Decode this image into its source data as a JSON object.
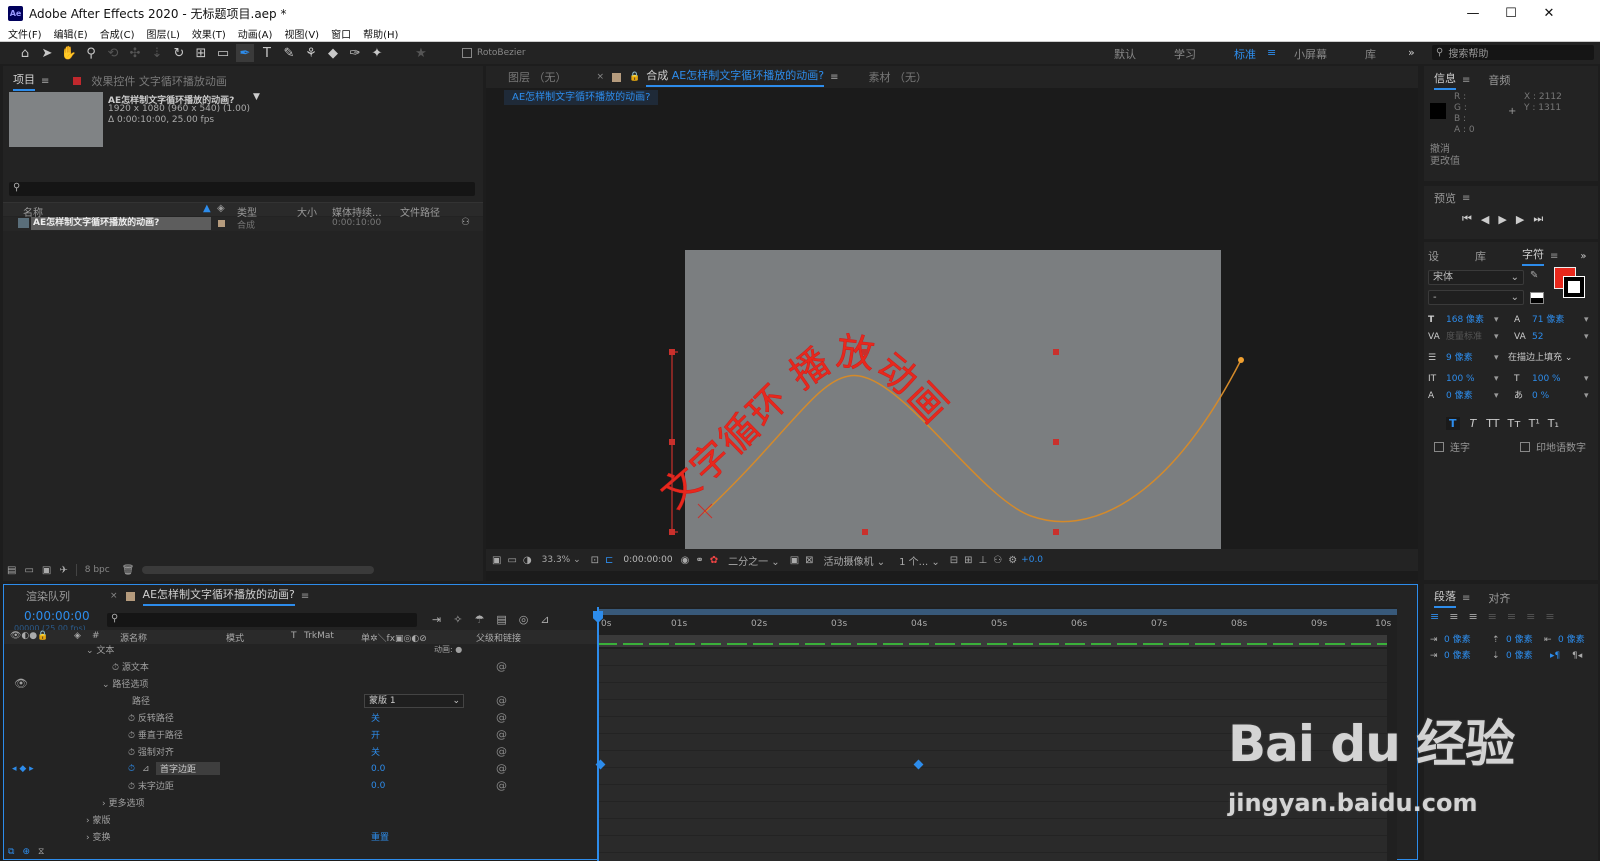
{
  "window": {
    "title": "Adobe After Effects 2020 - 无标题项目.aep *",
    "minimize": "—",
    "maximize": "☐",
    "close": "✕"
  },
  "menu": [
    "文件(F)",
    "编辑(E)",
    "合成(C)",
    "图层(L)",
    "效果(T)",
    "动画(A)",
    "视图(V)",
    "窗口",
    "帮助(H)"
  ],
  "toolbar": {
    "tools": [
      "home-icon",
      "selection-icon",
      "hand-icon",
      "zoom-icon",
      "orbit-icon",
      "pan-icon",
      "dolly-icon",
      "rotate-icon",
      "anchor-icon",
      "rectangle-icon",
      "pen-icon",
      "type-icon",
      "brush-icon",
      "clone-icon",
      "eraser-icon",
      "roto-icon",
      "puppet-icon"
    ],
    "rotobezier": "RotoBezier",
    "workspaces": [
      "默认",
      "学习",
      "标准",
      "小屏幕",
      "库"
    ],
    "active_workspace": "标准",
    "more": "»",
    "search_placeholder": "搜索帮助"
  },
  "project": {
    "tab_project": "项目",
    "tab_effects": "效果控件 文字循环播放动画",
    "comp_name": "AE怎样制文字循环播放的动画?",
    "comp_info1": "1920 x 1080 (960 x 540) (1.00)",
    "comp_info2": "Δ 0:00:10:00, 25.00 fps",
    "search_placeholder": "",
    "columns": [
      "名称",
      "类型",
      "大小",
      "媒体持续...",
      "文件路径"
    ],
    "item": {
      "name": "AE怎样制文字循环播放的动画?",
      "type": "合成",
      "duration": "0:00:10:00"
    },
    "footer_bpc": "8 bpc"
  },
  "viewer": {
    "tab_layer": "图层 （无）",
    "tab_comp": "合成",
    "comp_name": "AE怎样制文字循环播放的动画?",
    "tab_footage": "素材 （无）",
    "flow": "AE怎样制文字循环播放的动画?",
    "path_text": "文字循环 播放动画",
    "zoom": "33.3%",
    "timecode": "0:00:00:00",
    "resolution": "二分之一",
    "camera": "活动摄像机",
    "views": "1 个...",
    "exposure": "+0.0"
  },
  "info": {
    "tab_info": "信息",
    "tab_audio": "音频",
    "rgba": [
      "R :",
      "G :",
      "B :",
      "A : 0"
    ],
    "xy": [
      "X : 2112",
      "Y : 1311"
    ],
    "undo1": "撤消",
    "undo2": "更改值"
  },
  "preview": {
    "title": "预览"
  },
  "character": {
    "tab1": "设",
    "tab2": "库",
    "tab3": "字符",
    "font": "宋体",
    "style": "-",
    "size": "168 像素",
    "leading": "71 像素",
    "kerning": "度量标准",
    "tracking": "52",
    "stroke_width": "9 像素",
    "stroke_type": "在描边上填充",
    "vscale": "100 %",
    "hscale": "100 %",
    "baseline": "0 像素",
    "tsume": "0 %",
    "styles": [
      "T",
      "T",
      "TT",
      "Tт",
      "T¹",
      "T₁"
    ],
    "ligature": "连字",
    "hindi": "印地语数字",
    "fill_color": "#e8281c"
  },
  "paragraph": {
    "tab1": "段落",
    "tab2": "对齐",
    "fields": [
      "0 像素",
      "0 像素",
      "0 像素",
      "0 像素",
      "0 像素"
    ]
  },
  "timeline": {
    "tab_render": "渲染队列",
    "tab_comp": "AE怎样制文字循环播放的动画?",
    "timecode": "0:00:00:00",
    "fps": "00000 (25.00 fps)",
    "columns": {
      "source": "源名称",
      "mode": "模式",
      "t": "T",
      "trkmat": "TrkMat",
      "parent": "父级和链接"
    },
    "ruler": [
      "0s",
      "01s",
      "02s",
      "03s",
      "04s",
      "05s",
      "06s",
      "07s",
      "08s",
      "09s",
      "10s"
    ],
    "layers": [
      {
        "name": "文本",
        "indent": 1,
        "value": "",
        "extra": "动画: ●"
      },
      {
        "name": "源文本",
        "indent": 3,
        "value": ""
      },
      {
        "name": "路径选项",
        "indent": 2,
        "value": ""
      },
      {
        "name": "路径",
        "indent": 3,
        "value": "蒙版 1"
      },
      {
        "name": "反转路径",
        "indent": 4,
        "value": "关"
      },
      {
        "name": "垂直于路径",
        "indent": 4,
        "value": "开"
      },
      {
        "name": "强制对齐",
        "indent": 4,
        "value": "关"
      },
      {
        "name": "首字边距",
        "indent": 4,
        "value": "0.0"
      },
      {
        "name": "末字边距",
        "indent": 4,
        "value": "0.0"
      },
      {
        "name": "更多选项",
        "indent": 2,
        "value": ""
      },
      {
        "name": "蒙版",
        "indent": 1,
        "value": ""
      },
      {
        "name": "变换",
        "indent": 1,
        "value": "重置"
      }
    ]
  },
  "watermark": {
    "brand": "Bai du 经验",
    "url": "jingyan.baidu.com"
  }
}
